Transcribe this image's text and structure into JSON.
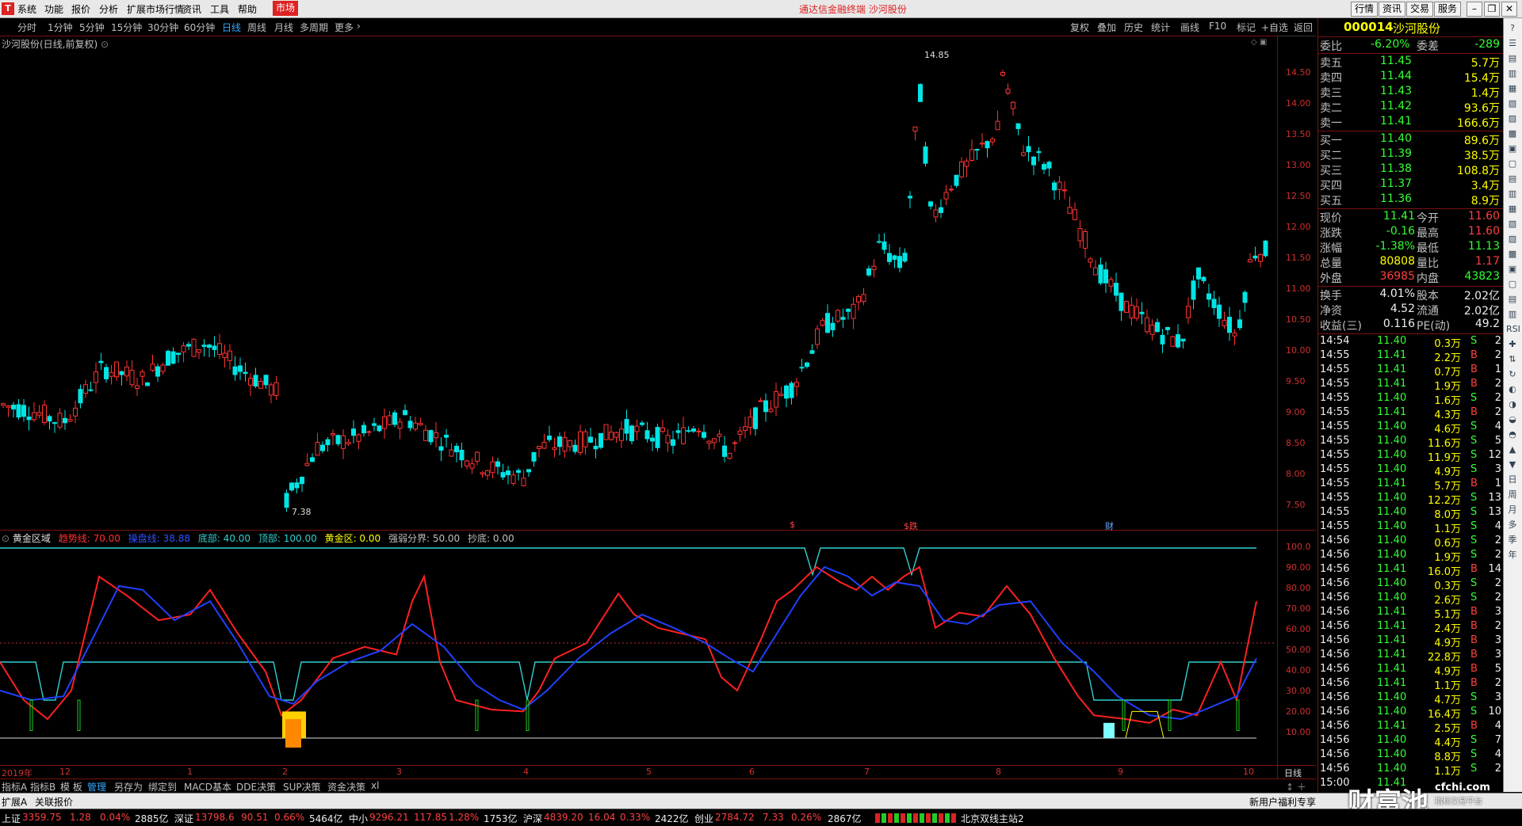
{
  "menubar": {
    "logo": "T",
    "items": [
      "系统",
      "功能",
      "报价",
      "分析",
      "扩展市场行情",
      "资讯",
      "工具",
      "帮助"
    ],
    "active_item": "市场",
    "title": "通达信金融终端  沙河股份",
    "right_buttons": [
      "行情",
      "资讯",
      "交易",
      "服务"
    ]
  },
  "periodbar": {
    "periods": [
      "分时",
      "1分钟",
      "5分钟",
      "15分钟",
      "30分钟",
      "60分钟",
      "日线",
      "周线",
      "月线",
      "多周期",
      "更多"
    ],
    "selected": "日线",
    "tools": [
      "复权",
      "叠加",
      "历史",
      "统计",
      "画线",
      "F10",
      "标记",
      "+自选",
      "返回"
    ]
  },
  "chart": {
    "title": "沙河股份(日线,前复权)",
    "price_axis": [
      "14.50",
      "14.00",
      "13.50",
      "13.00",
      "12.50",
      "12.00",
      "11.50",
      "11.00",
      "10.50",
      "10.00",
      "9.50",
      "9.00",
      "8.50",
      "8.00",
      "7.50"
    ],
    "high_label": "14.85",
    "low_label": "7.38",
    "event_markers": [
      "$",
      "$跌",
      "财"
    ],
    "date_axis": [
      "2019年",
      "12",
      "1",
      "2",
      "3",
      "4",
      "5",
      "6",
      "7",
      "8",
      "9",
      "10"
    ],
    "period_label": "日线"
  },
  "indicator": {
    "name": "黄金区域",
    "params": [
      {
        "label": "趋势线: 70.00",
        "color": "#ff3030"
      },
      {
        "label": "操盘线: 38.88",
        "color": "#3050ff"
      },
      {
        "label": "底部: 40.00",
        "color": "#30d0d0"
      },
      {
        "label": "顶部: 100.00",
        "color": "#30d0d0"
      },
      {
        "label": "黄金区: 0.00",
        "color": "#ffff00"
      },
      {
        "label": "强弱分界: 50.00",
        "color": "#c0c0c0"
      },
      {
        "label": "抄底: 0.00",
        "color": "#c0c0c0"
      }
    ],
    "axis": [
      "100.0",
      "90.00",
      "80.00",
      "70.00",
      "60.00",
      "50.00",
      "40.00",
      "30.00",
      "20.00",
      "10.00"
    ]
  },
  "quote": {
    "code": "000014",
    "name": "沙河股份",
    "weibi_label": "委比",
    "weibi": "-6.20%",
    "weicha_label": "委差",
    "weicha": "-289",
    "asks": [
      {
        "label": "卖五",
        "price": "11.45",
        "vol": "5.7万"
      },
      {
        "label": "卖四",
        "price": "11.44",
        "vol": "15.4万"
      },
      {
        "label": "卖三",
        "price": "11.43",
        "vol": "1.4万"
      },
      {
        "label": "卖二",
        "price": "11.42",
        "vol": "93.6万"
      },
      {
        "label": "卖一",
        "price": "11.41",
        "vol": "166.6万"
      }
    ],
    "bids": [
      {
        "label": "买一",
        "price": "11.40",
        "vol": "89.6万"
      },
      {
        "label": "买二",
        "price": "11.39",
        "vol": "38.5万"
      },
      {
        "label": "买三",
        "price": "11.38",
        "vol": "108.8万"
      },
      {
        "label": "买四",
        "price": "11.37",
        "vol": "3.4万"
      },
      {
        "label": "买五",
        "price": "11.36",
        "vol": "8.9万"
      }
    ],
    "stats": [
      {
        "l1": "现价",
        "v1": "11.41",
        "c1": "green",
        "l2": "今开",
        "v2": "11.60",
        "c2": "red"
      },
      {
        "l1": "涨跌",
        "v1": "-0.16",
        "c1": "green",
        "l2": "最高",
        "v2": "11.60",
        "c2": "red"
      },
      {
        "l1": "涨幅",
        "v1": "-1.38%",
        "c1": "green",
        "l2": "最低",
        "v2": "11.13",
        "c2": "green"
      },
      {
        "l1": "总量",
        "v1": "80808",
        "c1": "yellow",
        "l2": "量比",
        "v2": "1.17",
        "c2": "red"
      },
      {
        "l1": "外盘",
        "v1": "36985",
        "c1": "red",
        "l2": "内盘",
        "v2": "43823",
        "c2": "green"
      }
    ],
    "stats2": [
      {
        "l1": "换手",
        "v1": "4.01%",
        "l2": "股本",
        "v2": "2.02亿"
      },
      {
        "l1": "净资",
        "v1": "4.52",
        "l2": "流通",
        "v2": "2.02亿"
      },
      {
        "l1": "收益(三)",
        "v1": "0.116",
        "l2": "PE(动)",
        "v2": "49.2"
      }
    ],
    "ticks": [
      {
        "t": "14:54",
        "p": "11.40",
        "pc": "green",
        "v": "0.3万",
        "bs": "S",
        "n": "2"
      },
      {
        "t": "14:55",
        "p": "11.41",
        "pc": "green",
        "v": "2.2万",
        "bs": "B",
        "n": "2"
      },
      {
        "t": "14:55",
        "p": "11.41",
        "pc": "green",
        "v": "0.7万",
        "bs": "B",
        "n": "1"
      },
      {
        "t": "14:55",
        "p": "11.41",
        "pc": "green",
        "v": "1.9万",
        "bs": "B",
        "n": "2"
      },
      {
        "t": "14:55",
        "p": "11.40",
        "pc": "green",
        "v": "1.6万",
        "bs": "S",
        "n": "2"
      },
      {
        "t": "14:55",
        "p": "11.41",
        "pc": "green",
        "v": "4.3万",
        "bs": "B",
        "n": "2"
      },
      {
        "t": "14:55",
        "p": "11.40",
        "pc": "green",
        "v": "4.6万",
        "bs": "S",
        "n": "4"
      },
      {
        "t": "14:55",
        "p": "11.40",
        "pc": "green",
        "v": "11.6万",
        "bs": "S",
        "n": "5"
      },
      {
        "t": "14:55",
        "p": "11.40",
        "pc": "green",
        "v": "11.9万",
        "bs": "S",
        "n": "12"
      },
      {
        "t": "14:55",
        "p": "11.40",
        "pc": "green",
        "v": "4.9万",
        "bs": "S",
        "n": "3"
      },
      {
        "t": "14:55",
        "p": "11.41",
        "pc": "green",
        "v": "5.7万",
        "bs": "B",
        "n": "1"
      },
      {
        "t": "14:55",
        "p": "11.40",
        "pc": "green",
        "v": "12.2万",
        "bs": "S",
        "n": "13"
      },
      {
        "t": "14:55",
        "p": "11.40",
        "pc": "green",
        "v": "8.0万",
        "bs": "S",
        "n": "13"
      },
      {
        "t": "14:55",
        "p": "11.40",
        "pc": "green",
        "v": "1.1万",
        "bs": "S",
        "n": "4"
      },
      {
        "t": "14:56",
        "p": "11.40",
        "pc": "green",
        "v": "0.6万",
        "bs": "S",
        "n": "2"
      },
      {
        "t": "14:56",
        "p": "11.40",
        "pc": "green",
        "v": "1.9万",
        "bs": "S",
        "n": "2"
      },
      {
        "t": "14:56",
        "p": "11.41",
        "pc": "green",
        "v": "16.0万",
        "bs": "B",
        "n": "14"
      },
      {
        "t": "14:56",
        "p": "11.40",
        "pc": "green",
        "v": "0.3万",
        "bs": "S",
        "n": "2"
      },
      {
        "t": "14:56",
        "p": "11.40",
        "pc": "green",
        "v": "2.6万",
        "bs": "S",
        "n": "2"
      },
      {
        "t": "14:56",
        "p": "11.41",
        "pc": "green",
        "v": "5.1万",
        "bs": "B",
        "n": "3"
      },
      {
        "t": "14:56",
        "p": "11.41",
        "pc": "green",
        "v": "2.4万",
        "bs": "B",
        "n": "2"
      },
      {
        "t": "14:56",
        "p": "11.41",
        "pc": "green",
        "v": "4.9万",
        "bs": "B",
        "n": "3"
      },
      {
        "t": "14:56",
        "p": "11.41",
        "pc": "green",
        "v": "22.8万",
        "bs": "B",
        "n": "3"
      },
      {
        "t": "14:56",
        "p": "11.41",
        "pc": "green",
        "v": "4.9万",
        "bs": "B",
        "n": "5"
      },
      {
        "t": "14:56",
        "p": "11.41",
        "pc": "green",
        "v": "1.1万",
        "bs": "B",
        "n": "2"
      },
      {
        "t": "14:56",
        "p": "11.40",
        "pc": "green",
        "v": "4.7万",
        "bs": "S",
        "n": "3"
      },
      {
        "t": "14:56",
        "p": "11.40",
        "pc": "green",
        "v": "16.4万",
        "bs": "S",
        "n": "10"
      },
      {
        "t": "14:56",
        "p": "11.41",
        "pc": "green",
        "v": "2.5万",
        "bs": "B",
        "n": "4"
      },
      {
        "t": "14:56",
        "p": "11.40",
        "pc": "green",
        "v": "4.4万",
        "bs": "S",
        "n": "7"
      },
      {
        "t": "14:56",
        "p": "11.40",
        "pc": "green",
        "v": "8.8万",
        "bs": "S",
        "n": "4"
      },
      {
        "t": "14:56",
        "p": "11.40",
        "pc": "green",
        "v": "1.1万",
        "bs": "S",
        "n": "2"
      },
      {
        "t": "15:00",
        "p": "11.41",
        "pc": "green",
        "v": "",
        "bs": "",
        "n": ""
      }
    ]
  },
  "side_icons": [
    "?",
    "☰",
    "▤",
    "▥",
    "▦",
    "▧",
    "▨",
    "▩",
    "▣",
    "▢",
    "▤",
    "▥",
    "▦",
    "▧",
    "▨",
    "▩",
    "▣",
    "▢",
    "▤",
    "▥",
    "RSI",
    "✚",
    "⇅",
    "↻",
    "◐",
    "◑",
    "◒",
    "◓",
    "▲",
    "▼",
    "日",
    "周",
    "月",
    "多",
    "季",
    "年"
  ],
  "tabs": [
    "指标A",
    "指标B",
    "模 板",
    "管理",
    "另存为",
    "绑定到",
    "MACD基本",
    "DDE决策",
    "SUP决策",
    "资金决策",
    "xl"
  ],
  "ext": {
    "left": [
      "扩展A",
      "关联报价"
    ],
    "right": "新用户福利专享",
    "brand": "财富池",
    "site": "cfchi.com",
    "site_sub": "指标交易平台"
  },
  "status": [
    {
      "name": "上证",
      "val": "3359.75",
      "chg": "1.28",
      "pct": "0.04%",
      "amt": "2885亿"
    },
    {
      "name": "深证",
      "val": "13798.6",
      "chg": "90.51",
      "pct": "0.66%",
      "amt": "5464亿"
    },
    {
      "name": "中小",
      "val": "9296.21",
      "chg": "117.85",
      "pct": "1.28%",
      "amt": "1753亿"
    },
    {
      "name": "沪深",
      "val": "4839.20",
      "chg": "16.04",
      "pct": "0.33%",
      "amt": "2422亿"
    },
    {
      "name": "创业",
      "val": "2784.72",
      "chg": "7.33",
      "pct": "0.26%",
      "amt": "2867亿"
    }
  ],
  "server": "北京双线主站2"
}
